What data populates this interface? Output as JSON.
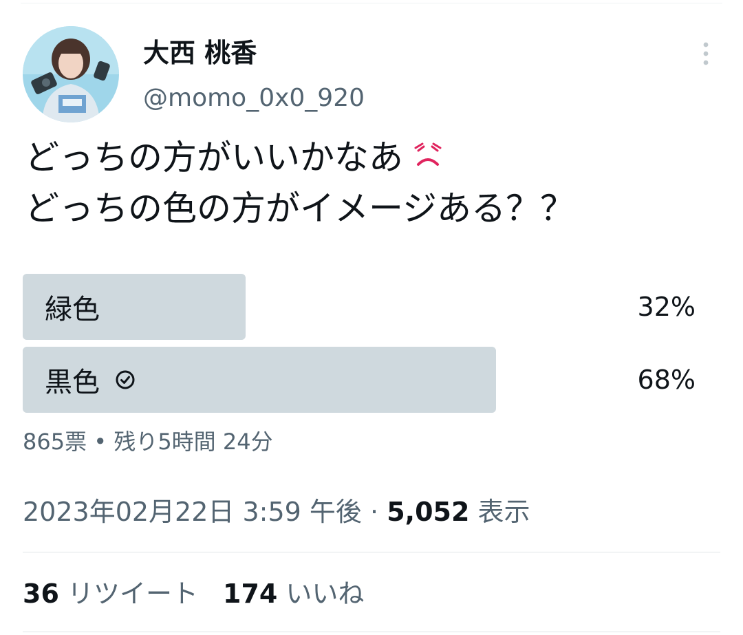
{
  "author": {
    "display_name": "大西 桃香",
    "handle": "@momo_0x0_920"
  },
  "more_icon": "more-vertical-icon",
  "tweet": {
    "line1": "どっちの方がいいかなあ",
    "line1_emoji": "frowning-face-emoji",
    "line2": "どっちの色の方がイメージある？？"
  },
  "poll": {
    "options": [
      {
        "label": "緑色",
        "percent_text": "32%",
        "percent": 32,
        "selected": false
      },
      {
        "label": "黒色",
        "percent_text": "68%",
        "percent": 68,
        "selected": true
      }
    ],
    "votes": "865票",
    "separator": "•",
    "remaining": "残り5時間 24分",
    "bar_color": "#cfd9de"
  },
  "timestamp": {
    "date_time": "2023年02月22日 3:59 午後",
    "separator": "·",
    "views_count": "5,052",
    "views_label": "表示"
  },
  "stats": {
    "retweets_count": "36",
    "retweets_label": "リツイート",
    "likes_count": "174",
    "likes_label": "いいね"
  },
  "colors": {
    "text": "#0f1419",
    "secondary": "#536471",
    "emoji_red": "#e0245e"
  }
}
